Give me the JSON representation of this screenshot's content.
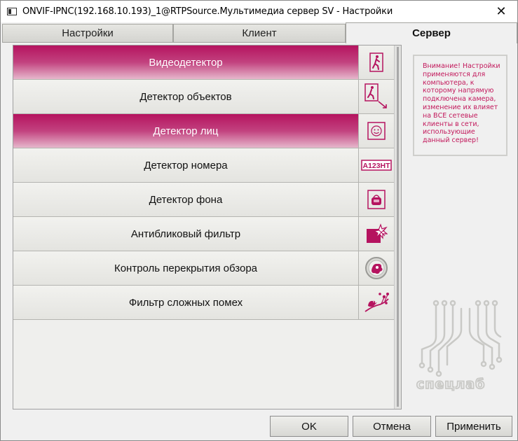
{
  "window": {
    "title": "ONVIF-IPNC(192.168.10.193)_1@RTPSource.Мультимедиа сервер SV - Настройки",
    "close_glyph": "✕"
  },
  "tabs": [
    {
      "label": "Настройки",
      "active": false
    },
    {
      "label": "Клиент",
      "active": false
    },
    {
      "label": "Сервер",
      "active": true
    }
  ],
  "modules": [
    {
      "label": "Видеодетектор",
      "active": true,
      "icon": "walking-person-icon"
    },
    {
      "label": "Детектор объектов",
      "active": false,
      "icon": "person-arrow-icon"
    },
    {
      "label": "Детектор лиц",
      "active": true,
      "icon": "face-icon"
    },
    {
      "label": "Детектор номера",
      "active": false,
      "icon": "license-plate-icon",
      "icon_text": "A123HT"
    },
    {
      "label": "Детектор фона",
      "active": false,
      "icon": "bag-icon"
    },
    {
      "label": "Антибликовый фильтр",
      "active": false,
      "icon": "glare-filter-icon"
    },
    {
      "label": "Контроль перекрытия обзора",
      "active": false,
      "icon": "lens-cover-icon"
    },
    {
      "label": "Фильтр сложных помех",
      "active": false,
      "icon": "bird-branch-icon"
    }
  ],
  "notice": {
    "text": "Внимание! Настройки применяются для компьютера, к которому напрямую подключена камера, изменение их влияет на ВСЕ сетевые клиенты в сети, использующие данный сервер!"
  },
  "brand": {
    "name": "спецлаб",
    "logo": "speclab-logo"
  },
  "buttons": {
    "ok": "OK",
    "cancel": "Отмена",
    "apply": "Применить"
  },
  "colors": {
    "accent": "#b5135f",
    "notice_text": "#c2185b"
  }
}
